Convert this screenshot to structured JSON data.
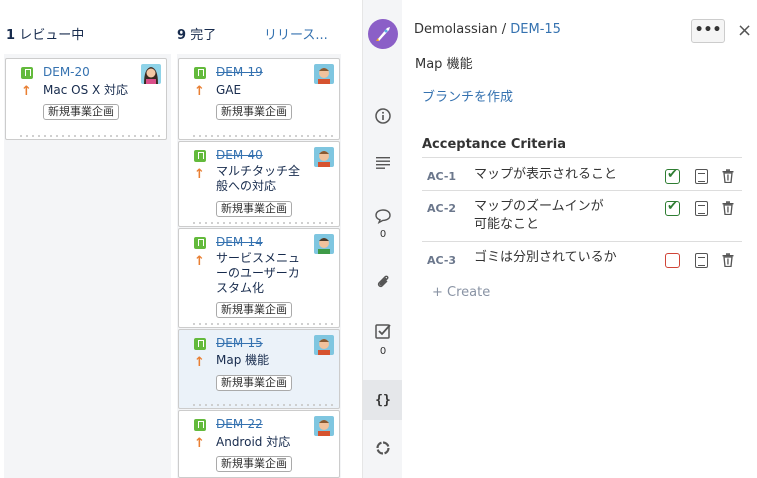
{
  "columns": [
    {
      "count": "1",
      "name": "レビュー中",
      "link": ""
    },
    {
      "count": "9",
      "name": "完了",
      "link": "リリース..."
    }
  ],
  "cards": [
    {
      "key": "DEM-20",
      "summary": [
        "Mac OS X 対応"
      ],
      "epic": "新規事業企画",
      "done": false,
      "avatar": "female-avatar"
    },
    {
      "key": "DEM-19",
      "summary": [
        "GAE"
      ],
      "epic": "新規事業企画",
      "done": true,
      "avatar": "male-avatar"
    },
    {
      "key": "DEM-40",
      "summary": [
        "マルチタッチ全",
        "般への対応"
      ],
      "epic": "新規事業企画",
      "done": true,
      "avatar": "male-avatar"
    },
    {
      "key": "DEM-14",
      "summary": [
        "サービスメニュ",
        "ーのユーザーカ",
        "スタム化"
      ],
      "epic": "新規事業企画",
      "done": true,
      "avatar": "male-avatar-green"
    },
    {
      "key": "DEM-15",
      "summary": [
        "Map 機能"
      ],
      "epic": "新規事業企画",
      "done": true,
      "avatar": "male-avatar"
    },
    {
      "key": "DEM-22",
      "summary": [
        "Android 対応"
      ],
      "epic": "新規事業企画",
      "done": true,
      "avatar": "male-avatar"
    }
  ],
  "rail": {
    "comments_count": "0",
    "checklist_count": "0",
    "icons": [
      "project-avatar-icon",
      "info-icon",
      "description-icon",
      "comment-icon",
      "attachment-icon",
      "checklist-icon",
      "code-icon",
      "refresh-icon"
    ]
  },
  "detail": {
    "project": "Demolassian",
    "separator": "/",
    "issue_key": "DEM-15",
    "title": "Map 機能",
    "more_label": "•••",
    "close_label": "×",
    "branch_link": "ブランチを作成",
    "ac_heading": "Acceptance Criteria",
    "criteria": [
      {
        "id": "AC-1",
        "text": "マップが表示されること",
        "checked": true
      },
      {
        "id": "AC-2",
        "text": "マップのズームインが可能なこと",
        "checked": true
      },
      {
        "id": "AC-3",
        "text": "ゴミは分別されているか",
        "checked": false
      }
    ],
    "create_label": "+ Create"
  },
  "colors": {
    "link": "#3572b0",
    "story": "#63ba3c",
    "priority": "#e97f33",
    "checked": "#2e7d32",
    "unchecked": "#d04437"
  }
}
